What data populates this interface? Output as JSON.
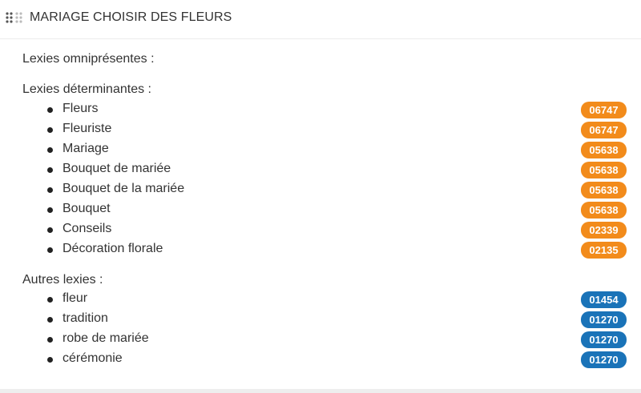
{
  "header": {
    "title": "MARIAGE CHOISIR DES FLEURS",
    "icon": "grip-dots-icon"
  },
  "colors": {
    "determinant_badge": "#f28b1b",
    "other_badge": "#1a73b8"
  },
  "sections": {
    "omnipresent": {
      "label": "Lexies omniprésentes :"
    },
    "determinant": {
      "label": "Lexies déterminantes :",
      "items": [
        {
          "label": "Fleurs",
          "score": "06747"
        },
        {
          "label": "Fleuriste",
          "score": "06747"
        },
        {
          "label": "Mariage",
          "score": "05638"
        },
        {
          "label": "Bouquet de mariée",
          "score": "05638"
        },
        {
          "label": "Bouquet de la mariée",
          "score": "05638"
        },
        {
          "label": "Bouquet",
          "score": "05638"
        },
        {
          "label": "Conseils",
          "score": "02339"
        },
        {
          "label": "Décoration florale",
          "score": "02135"
        }
      ]
    },
    "other": {
      "label": "Autres lexies :",
      "items": [
        {
          "label": "fleur",
          "score": "01454"
        },
        {
          "label": "tradition",
          "score": "01270"
        },
        {
          "label": "robe de mariée",
          "score": "01270"
        },
        {
          "label": "cérémonie",
          "score": "01270"
        }
      ]
    }
  }
}
